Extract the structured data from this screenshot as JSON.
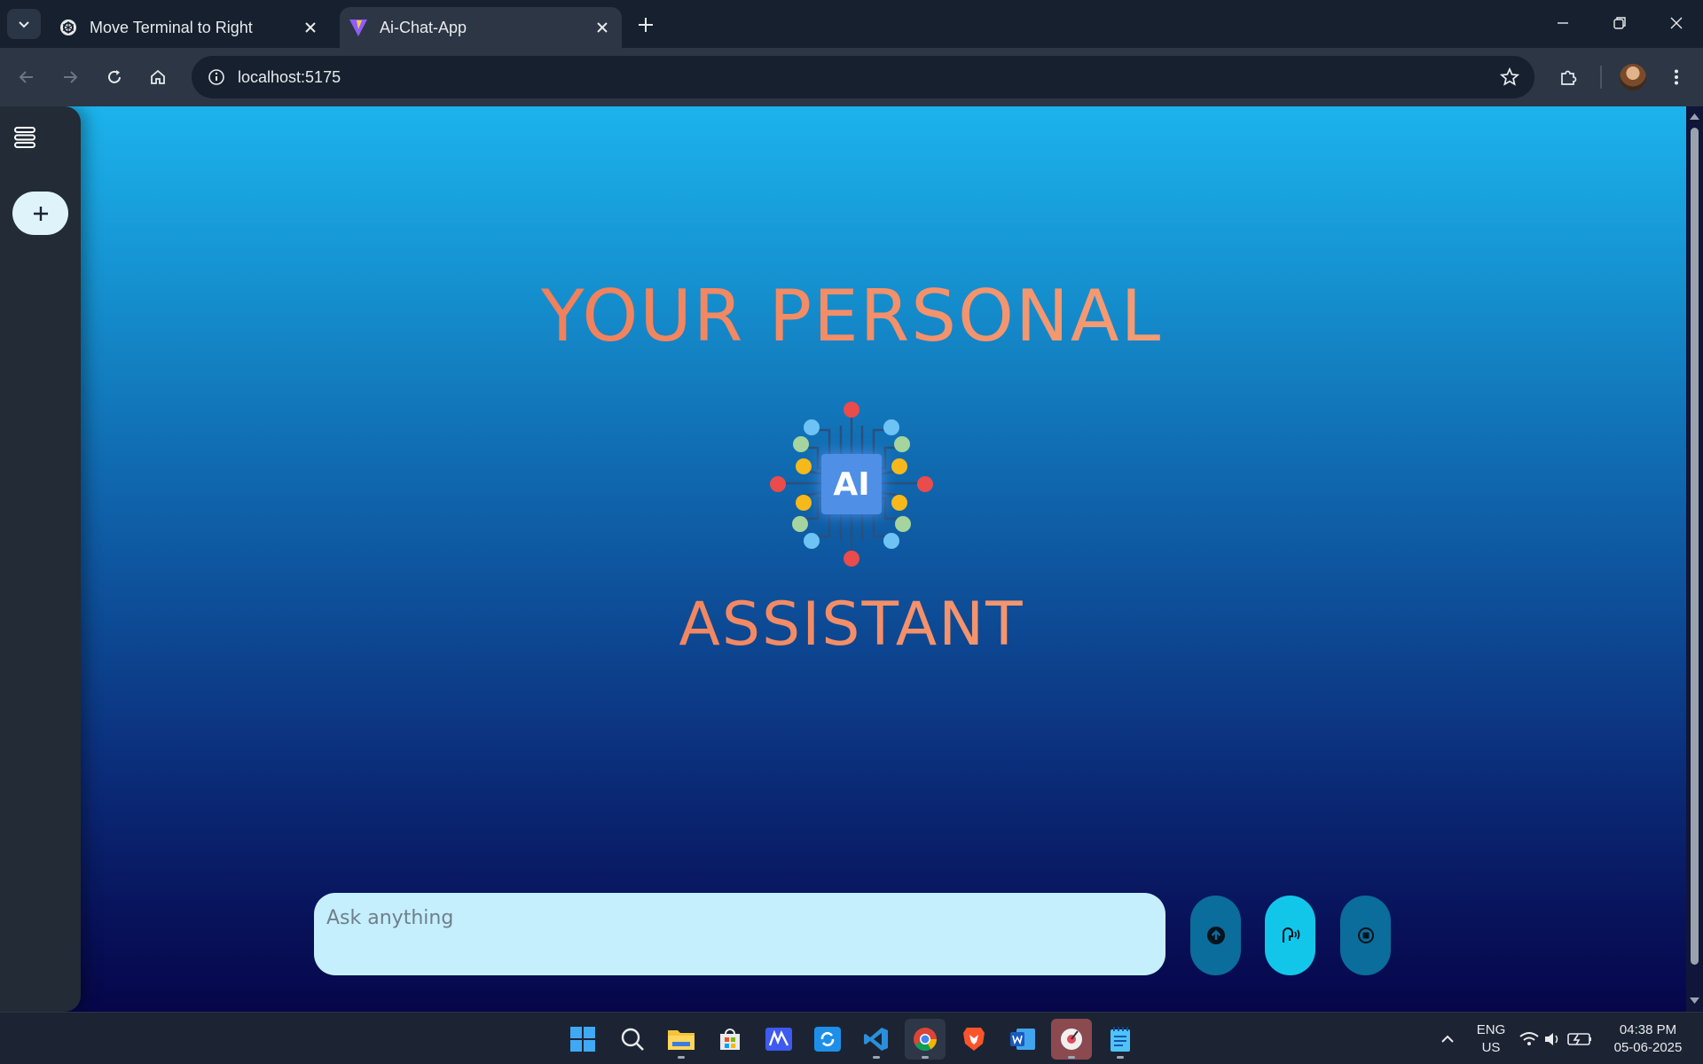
{
  "browser": {
    "tabs": [
      {
        "title": "Move Terminal to Right",
        "active": false,
        "favicon": "chatgpt-icon"
      },
      {
        "title": "Ai-Chat-App",
        "active": true,
        "favicon": "vite-icon"
      }
    ],
    "address": "localhost:5175"
  },
  "page": {
    "hero_top": "YOUR PERSONAL",
    "hero_bottom": "ASSISTANT",
    "logo_text": "AI",
    "input_placeholder": "Ask anything",
    "input_value": ""
  },
  "taskbar": {
    "apps": [
      "windows-start-icon",
      "search-icon",
      "file-explorer-icon",
      "microsoft-store-icon",
      "app-m-icon",
      "app-sync-icon",
      "vscode-icon",
      "chrome-icon",
      "brave-icon",
      "word-icon",
      "music-app-icon",
      "notepad-icon"
    ],
    "language_line1": "ENG",
    "language_line2": "US",
    "time": "04:38 PM",
    "date": "05-06-2025"
  },
  "colors": {
    "accent_orange": "#f06a45",
    "composer_bg": "#c5effd",
    "sidebar_bg": "#222b36"
  }
}
